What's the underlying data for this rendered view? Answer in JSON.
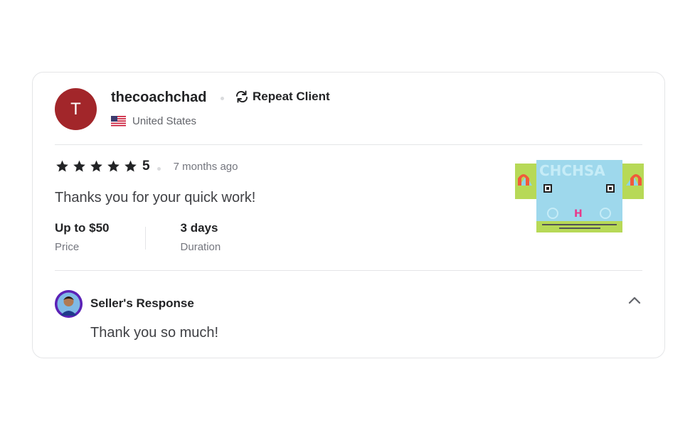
{
  "review": {
    "avatar_letter": "T",
    "username": "thecoachchad",
    "repeat_label": "Repeat Client",
    "country": "United States",
    "rating": "5",
    "stars": 5,
    "time_ago": "7 months ago",
    "text": "Thanks you for your quick work!",
    "price_value": "Up to $50",
    "price_label": "Price",
    "duration_value": "3 days",
    "duration_label": "Duration"
  },
  "seller_response": {
    "title": "Seller's Response",
    "text": "Thank you so much!"
  },
  "icons": {
    "repeat": "repeat-icon",
    "flag": "us-flag-icon",
    "star": "star-icon",
    "collapse": "chevron-up-icon"
  },
  "colors": {
    "avatar_bg": "#a2262a",
    "star": "#222325",
    "text_primary": "#222325",
    "text_muted": "#74767e",
    "border": "#e4e5e7"
  }
}
